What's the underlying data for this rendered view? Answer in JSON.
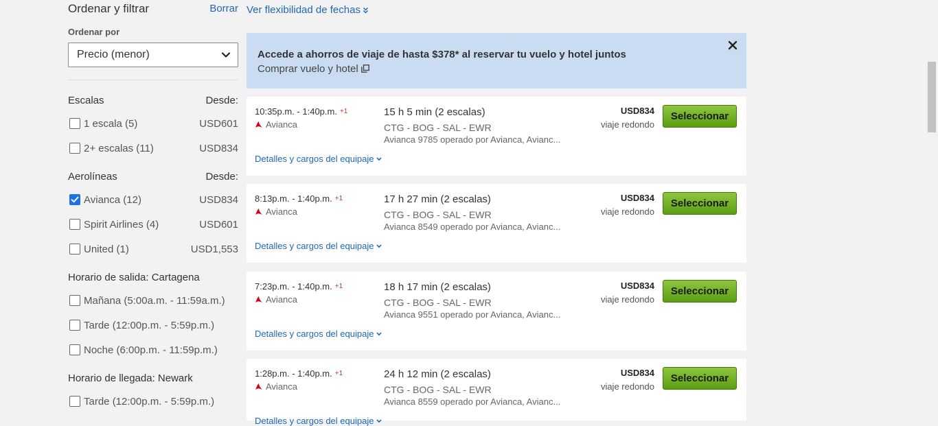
{
  "sidebar": {
    "title": "Ordenar y filtrar",
    "clear_label": "Borrar",
    "sort_label": "Ordenar por",
    "sort_value": "Precio (menor)",
    "stops": {
      "heading": "Escalas",
      "from_label": "Desde:",
      "options": [
        {
          "label": "1 escala (5)",
          "price": "USD601",
          "checked": false
        },
        {
          "label": "2+ escalas (11)",
          "price": "USD834",
          "checked": false
        }
      ]
    },
    "airlines": {
      "heading": "Aerolíneas",
      "from_label": "Desde:",
      "options": [
        {
          "label": "Avianca (12)",
          "price": "USD834",
          "checked": true
        },
        {
          "label": "Spirit Airlines (4)",
          "price": "USD601",
          "checked": false
        },
        {
          "label": "United (1)",
          "price": "USD1,553",
          "checked": false
        }
      ]
    },
    "departure": {
      "heading": "Horario de salida: Cartagena",
      "options": [
        {
          "label": "Mañana (5:00a.m. - 11:59a.m.)",
          "checked": false
        },
        {
          "label": "Tarde (12:00p.m. - 5:59p.m.)",
          "checked": false
        },
        {
          "label": "Noche (6:00p.m. - 11:59p.m.)",
          "checked": false
        }
      ]
    },
    "arrival": {
      "heading": "Horario de llegada: Newark",
      "options": [
        {
          "label": "Tarde (12:00p.m. - 5:59p.m.)",
          "checked": false
        }
      ]
    }
  },
  "main": {
    "flex_link": "Ver flexibilidad de fechas",
    "promo": {
      "title": "Accede a ahorros de viaje de hasta $378* al reservar tu vuelo y hotel juntos",
      "link": "Comprar vuelo y hotel"
    },
    "results": [
      {
        "time": "10:35p.m. - 1:40p.m.",
        "plus": "+1",
        "airline": "Avianca",
        "duration": "15 h 5 min (2 escalas)",
        "route": "CTG - BOG - SAL - EWR",
        "operated": "Avianca 9785 operado por Avianca, Avianc...",
        "price": "USD834",
        "trip": "viaje redondo",
        "button": "Seleccionar",
        "details": "Detalles y cargos del equipaje"
      },
      {
        "time": "8:13p.m. - 1:40p.m.",
        "plus": "+1",
        "airline": "Avianca",
        "duration": "17 h 27 min (2 escalas)",
        "route": "CTG - BOG - SAL - EWR",
        "operated": "Avianca 8549 operado por Avianca, Avianc...",
        "price": "USD834",
        "trip": "viaje redondo",
        "button": "Seleccionar",
        "details": "Detalles y cargos del equipaje"
      },
      {
        "time": "7:23p.m. - 1:40p.m.",
        "plus": "+1",
        "airline": "Avianca",
        "duration": "18 h 17 min (2 escalas)",
        "route": "CTG - BOG - SAL - EWR",
        "operated": "Avianca 9551 operado por Avianca, Avianc...",
        "price": "USD834",
        "trip": "viaje redondo",
        "button": "Seleccionar",
        "details": "Detalles y cargos del equipaje"
      },
      {
        "time": "1:28p.m. - 1:40p.m.",
        "plus": "+1",
        "airline": "Avianca",
        "duration": "24 h 12 min (2 escalas)",
        "route": "CTG - BOG - SAL - EWR",
        "operated": "Avianca 8559 operado por Avianca, Avianc...",
        "price": "USD834",
        "trip": "viaje redondo",
        "button": "Seleccionar",
        "details": "Detalles y cargos del equipaje"
      }
    ]
  },
  "colors": {
    "link": "#1f66b5",
    "button": "#6aab1f",
    "promo_bg": "#c9dcf2",
    "airline_logo": "#d0021b"
  },
  "icons": {
    "sort_chevron": "chevron-down-icon",
    "flex": "double-chevron-down-icon",
    "promo_close": "close-icon",
    "promo_link": "external-link-icon",
    "airline": "avianca-logo-icon",
    "details": "chevron-down-icon"
  }
}
